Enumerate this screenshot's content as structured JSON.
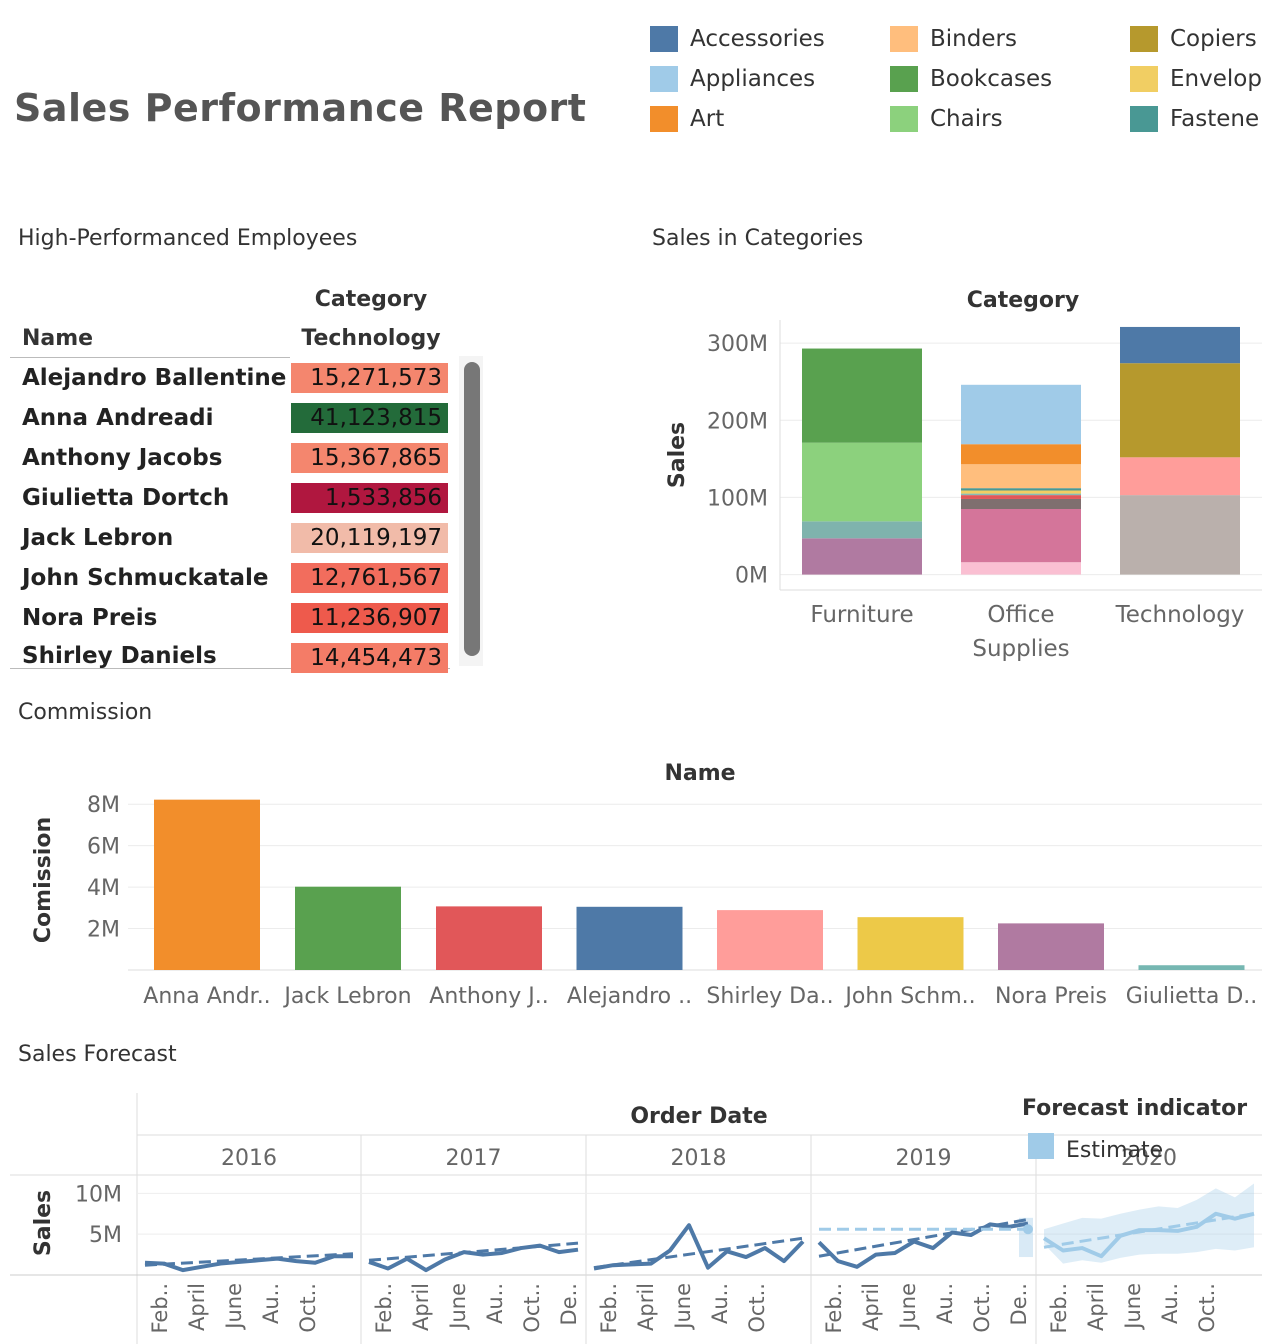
{
  "report_title": "Sales Performance Report",
  "legend": [
    {
      "label": "Accessories",
      "color": "#4e79a7"
    },
    {
      "label": "Appliances",
      "color": "#a0cbe8"
    },
    {
      "label": "Art",
      "color": "#f28e2b"
    },
    {
      "label": "Binders",
      "color": "#ffbe7d"
    },
    {
      "label": "Bookcases",
      "color": "#59a14f"
    },
    {
      "label": "Chairs",
      "color": "#8cd17d"
    },
    {
      "label": "Copiers",
      "color": "#b6992d"
    },
    {
      "label": "Envelop",
      "color": "#f1ce63"
    },
    {
      "label": "Fastene",
      "color": "#499894"
    }
  ],
  "employees_section": {
    "title": "High-Performanced Employees",
    "column_group_header": "Category",
    "row_header": "Name",
    "column_header": "Technology",
    "rows": [
      {
        "name": "Alejandro Ballentine",
        "value": "15,271,573",
        "color": "#f4866e"
      },
      {
        "name": "Anna Andreadi",
        "value": "41,123,815",
        "color": "#236b3a"
      },
      {
        "name": "Anthony Jacobs",
        "value": "15,367,865",
        "color": "#f4866e"
      },
      {
        "name": "Giulietta Dortch",
        "value": "1,533,856",
        "color": "#b0173f"
      },
      {
        "name": "Jack Lebron",
        "value": "20,119,197",
        "color": "#f1bba9"
      },
      {
        "name": "John Schmuckatale",
        "value": "12,761,567",
        "color": "#f26d5d"
      },
      {
        "name": "Nora Preis",
        "value": "11,236,907",
        "color": "#ee5a4c"
      },
      {
        "name": "Shirley Daniels",
        "value": "14,454,473",
        "color": "#f47c67"
      }
    ]
  },
  "chart_data": [
    {
      "id": "sales-in-categories",
      "section_title": "Sales in Categories",
      "type": "bar",
      "stacked": true,
      "title": "Category",
      "ylabel": "Sales",
      "categories": [
        "Furniture",
        "Office\nSupplies",
        "Technology"
      ],
      "yticks": [
        "0M",
        "100M",
        "200M",
        "300M"
      ],
      "ylim": [
        -20,
        330
      ],
      "segments": [
        [
          {
            "value": 47,
            "color": "#b07aa1"
          },
          {
            "value": 22,
            "color": "#7fb3ad"
          },
          {
            "value": 102,
            "color": "#8cd17d"
          },
          {
            "value": 122,
            "color": "#59a14f"
          }
        ],
        [
          {
            "value": 16,
            "color": "#fabfd2"
          },
          {
            "value": 69,
            "color": "#d4759a"
          },
          {
            "value": 13,
            "color": "#7f6f6f"
          },
          {
            "value": 5,
            "color": "#e15759"
          },
          {
            "value": 2,
            "color": "#86bcb6"
          },
          {
            "value": 4,
            "color": "#f1ce63"
          },
          {
            "value": 3,
            "color": "#499894"
          },
          {
            "value": 31,
            "color": "#ffbe7d"
          },
          {
            "value": 26,
            "color": "#f28e2b"
          },
          {
            "value": 77,
            "color": "#a0cbe8"
          }
        ],
        [
          {
            "value": 103,
            "color": "#bab0ac"
          },
          {
            "value": 49,
            "color": "#ff9d9a"
          },
          {
            "value": 122,
            "color": "#b6992d"
          },
          {
            "value": 47,
            "color": "#4e79a7"
          }
        ]
      ]
    },
    {
      "id": "commission",
      "section_title": "Commission",
      "type": "bar",
      "title": "Name",
      "ylabel": "Comission",
      "categories": [
        "Anna Andr..",
        "Jack Lebron",
        "Anthony J..",
        "Alejandro ..",
        "Shirley Da..",
        "John Schm..",
        "Nora Preis",
        "Giulietta D.."
      ],
      "values": [
        8.22,
        4.02,
        3.07,
        3.05,
        2.89,
        2.55,
        2.25,
        0.23
      ],
      "colors": [
        "#f28e2b",
        "#59a14f",
        "#e15759",
        "#4e79a7",
        "#ff9d9a",
        "#edc948",
        "#b07aa1",
        "#76b7b2"
      ],
      "yticks": [
        "2M",
        "4M",
        "6M",
        "8M"
      ],
      "ylim": [
        0,
        8.3
      ]
    },
    {
      "id": "sales-forecast",
      "section_title": "Sales Forecast",
      "type": "line",
      "title": "Order Date",
      "ylabel": "Sales",
      "years": [
        "2016",
        "2017",
        "2018",
        "2019",
        "2020"
      ],
      "yticks": [
        "5M",
        "10M"
      ],
      "ylim": [
        0,
        12
      ],
      "month_labels": [
        [
          "Feb..",
          "April",
          "June",
          "Au..",
          "Oct.."
        ],
        [
          "Feb..",
          "April",
          "June",
          "Au..",
          "Oct..",
          "De.."
        ],
        [
          "Feb..",
          "April",
          "June",
          "Au..",
          "Oct.."
        ],
        [
          "Feb..",
          "April",
          "June",
          "Au..",
          "Oct..",
          "De.."
        ],
        [
          "Feb..",
          "April",
          "June",
          "Au..",
          "Oct.."
        ]
      ],
      "actual": [
        1.5,
        1.4,
        0.6,
        1.0,
        1.4,
        1.6,
        1.8,
        2.0,
        1.7,
        1.5,
        2.3,
        2.3,
        2.5,
        1.6,
        0.8,
        2.0,
        0.6,
        1.9,
        2.8,
        2.5,
        2.7,
        3.3,
        3.6,
        2.8,
        3.1,
        0.8,
        1.2,
        1.3,
        1.4,
        3.0,
        6.1,
        0.9,
        2.9,
        2.2,
        3.3,
        1.7,
        4.1,
        4.0,
        1.7,
        1.0,
        2.5,
        2.7,
        4.1,
        3.3,
        5.2,
        4.9,
        6.2,
        5.9,
        6.3
      ],
      "trend": [
        [
          1.2,
          2.6
        ],
        [
          1.8,
          3.9
        ],
        [
          0.9,
          4.5
        ],
        [
          2.3,
          6.8
        ]
      ],
      "forecast_estimate": [
        4.5,
        3.0,
        3.3,
        2.3,
        4.8,
        5.5,
        5.5,
        5.4,
        5.9,
        7.5,
        6.9,
        7.5
      ],
      "forecast_trend": [
        3.4,
        7.5
      ],
      "forecast_low": [
        3.8,
        1.4,
        1.8,
        1.5,
        2.1,
        2.5,
        2.6,
        2.6,
        2.8,
        3.2,
        3.0,
        3.4
      ],
      "forecast_high": [
        5.6,
        6.3,
        7.0,
        6.9,
        7.5,
        8.0,
        8.4,
        8.2,
        9.2,
        10.6,
        9.5,
        11.2
      ],
      "forecast_2019_estimate": 5.6,
      "legend_title": "Forecast indicator",
      "legend_item": "Estimate",
      "color_actual": "#4e79a7",
      "color_estimate": "#a0cbe8"
    }
  ]
}
